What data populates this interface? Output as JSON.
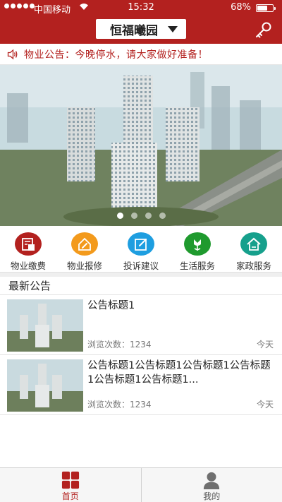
{
  "status_bar": {
    "carrier": "中国移动",
    "time": "15:32",
    "battery": "68%",
    "battery_level": 0.68
  },
  "header": {
    "community_name": "恒福曦园"
  },
  "notice": {
    "text": "物业公告：今晚停水，请大家做好准备！"
  },
  "banner": {
    "slide_count": 4,
    "active_index": 0
  },
  "menu": [
    {
      "label": "物业缴费",
      "icon": "bill-icon",
      "color": "#b3211f"
    },
    {
      "label": "物业报修",
      "icon": "repair-icon",
      "color": "#f39a1c"
    },
    {
      "label": "投诉建议",
      "icon": "edit-icon",
      "color": "#1e9ee0"
    },
    {
      "label": "生活服务",
      "icon": "flower-icon",
      "color": "#1f9a2e"
    },
    {
      "label": "家政服务",
      "icon": "house-icon",
      "color": "#16a08c"
    }
  ],
  "announcements": {
    "title": "最新公告",
    "items": [
      {
        "title": "公告标题1",
        "views": "浏览次数：1234",
        "date": "今天"
      },
      {
        "title": "公告标题1公告标题1公告标题1公告标题1公告标题1公告标题1...",
        "views": "浏览次数：1234",
        "date": "今天"
      }
    ]
  },
  "tabbar": [
    {
      "label": "首页",
      "active": true
    },
    {
      "label": "我的",
      "active": false
    }
  ],
  "colors": {
    "brand": "#b3211f"
  }
}
